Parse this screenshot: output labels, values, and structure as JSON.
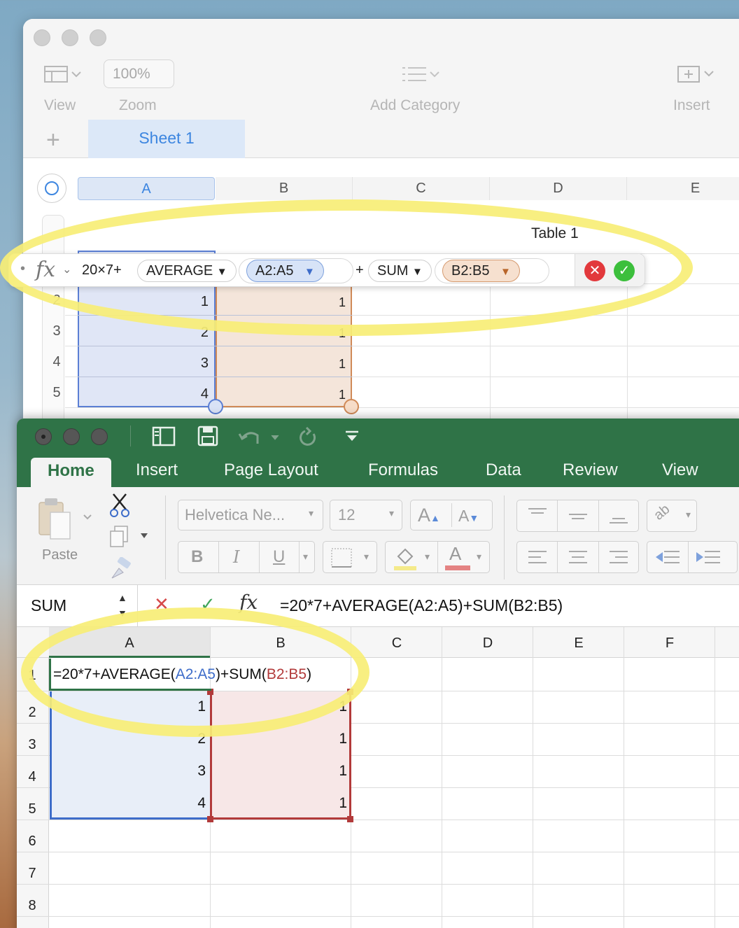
{
  "numbers": {
    "toolbar": {
      "view_label": "View",
      "zoom_value": "100%",
      "zoom_label": "Zoom",
      "add_category_label": "Add Category",
      "insert_label": "Insert"
    },
    "sheet_tab": "Sheet 1",
    "table_title": "Table 1",
    "columns": [
      "A",
      "B",
      "C",
      "D",
      "E"
    ],
    "rows": [
      "2",
      "3",
      "4",
      "5"
    ],
    "col_a": [
      "1",
      "2",
      "3",
      "4"
    ],
    "col_b": [
      "1",
      "1",
      "1",
      "1"
    ],
    "formula": {
      "prefix_text": "20×7+",
      "func1": "AVERAGE",
      "range1": "A2:A5",
      "plus": "+",
      "func2": "SUM",
      "range2": "B2:B5",
      "fx_label": "fx"
    }
  },
  "excel": {
    "tabs": [
      "Home",
      "Insert",
      "Page Layout",
      "Formulas",
      "Data",
      "Review",
      "View"
    ],
    "paste_label": "Paste",
    "font_name": "Helvetica Ne...",
    "font_size": "12",
    "bold": "B",
    "italic": "I",
    "underline": "U",
    "name_box": "SUM",
    "fx_label": "fx",
    "formula": "=20*7+AVERAGE(A2:A5)+SUM(B2:B5)",
    "cell_formula": {
      "part1": "=20*7+AVERAGE(",
      "range1": "A2:A5",
      "part2": ")+SUM(",
      "range2": "B2:B5",
      "part3": ")"
    },
    "columns": [
      "A",
      "B",
      "C",
      "D",
      "E",
      "F"
    ],
    "rows": [
      "1",
      "2",
      "3",
      "4",
      "5",
      "6",
      "7",
      "8"
    ],
    "col_a": [
      "1",
      "2",
      "3",
      "4"
    ],
    "col_b": [
      "1",
      "1",
      "1",
      "1"
    ]
  },
  "colors": {
    "excel_green": "#2f7347",
    "range_blue": "#3d6cc9",
    "range_red": "#b23a3a",
    "highlight_yellow": "#f7ee76"
  }
}
